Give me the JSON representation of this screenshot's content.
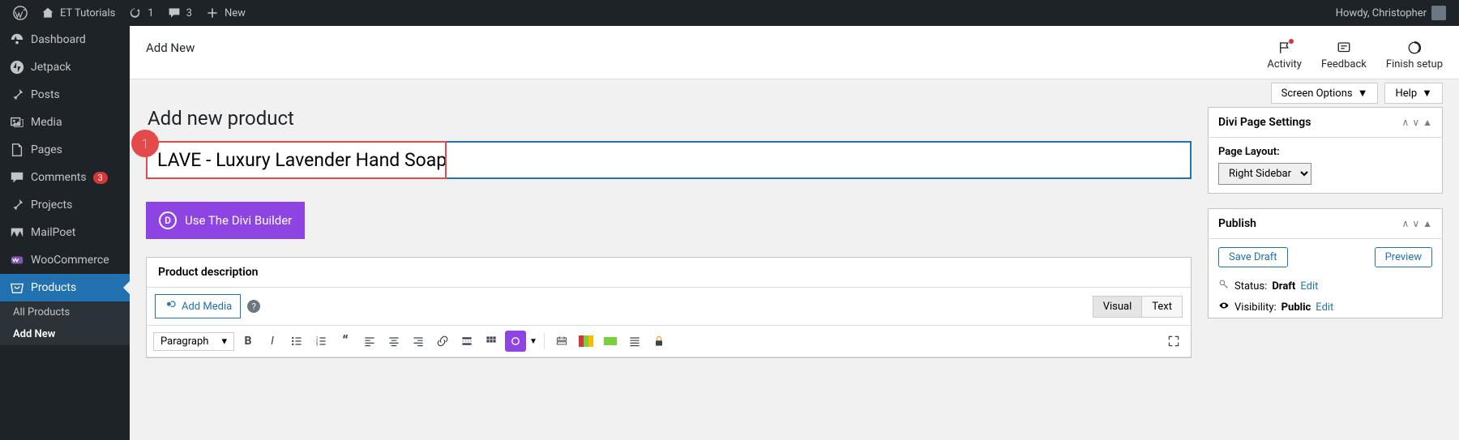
{
  "adminbar": {
    "site_name": "ET Tutorials",
    "update_count": "1",
    "comment_count": "3",
    "new_label": "New",
    "greeting": "Howdy, Christopher"
  },
  "sidebar": {
    "items": [
      {
        "label": "Dashboard"
      },
      {
        "label": "Jetpack"
      },
      {
        "label": "Posts"
      },
      {
        "label": "Media"
      },
      {
        "label": "Pages"
      },
      {
        "label": "Comments",
        "badge": "3"
      },
      {
        "label": "Projects"
      },
      {
        "label": "MailPoet"
      },
      {
        "label": "WooCommerce"
      },
      {
        "label": "Products",
        "current": true
      }
    ],
    "sub": [
      {
        "label": "All Products"
      },
      {
        "label": "Add New",
        "current": true
      }
    ]
  },
  "header": {
    "breadcrumb": "Add New",
    "activity": "Activity",
    "feedback": "Feedback",
    "finish": "Finish setup"
  },
  "screen": {
    "options": "Screen Options",
    "help": "Help"
  },
  "callout": {
    "number": "1"
  },
  "page": {
    "title": "Add new product",
    "product_name": "LAVE - Luxury Lavender Hand Soap",
    "divi_button": "Use The Divi Builder",
    "desc_heading": "Product description",
    "add_media": "Add Media",
    "visual_tab": "Visual",
    "text_tab": "Text",
    "format_select": "Paragraph"
  },
  "side": {
    "divi_settings": {
      "title": "Divi Page Settings",
      "layout_label": "Page Layout:",
      "layout_value": "Right Sidebar"
    },
    "publish": {
      "title": "Publish",
      "save_draft": "Save Draft",
      "preview": "Preview",
      "status_label": "Status:",
      "status_value": "Draft",
      "visibility_label": "Visibility:",
      "visibility_value": "Public",
      "edit": "Edit"
    }
  }
}
